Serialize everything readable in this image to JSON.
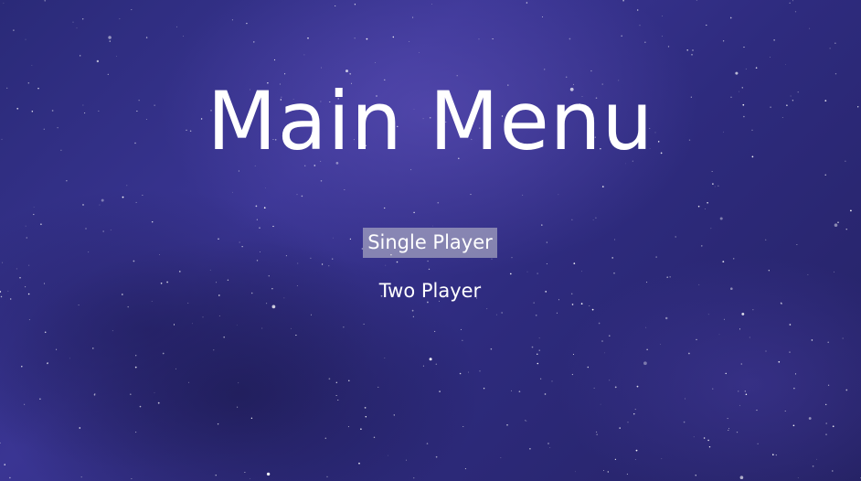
{
  "screen": {
    "title": "Main Menu",
    "menu": {
      "items": [
        {
          "label": "Single Player",
          "selected": true
        },
        {
          "label": "Two Player",
          "selected": false
        }
      ]
    }
  },
  "colors": {
    "background_primary": "#2e2b7e",
    "background_glow": "#6254be",
    "text": "#ffffff",
    "selection_highlight": "#c8c8d2"
  }
}
